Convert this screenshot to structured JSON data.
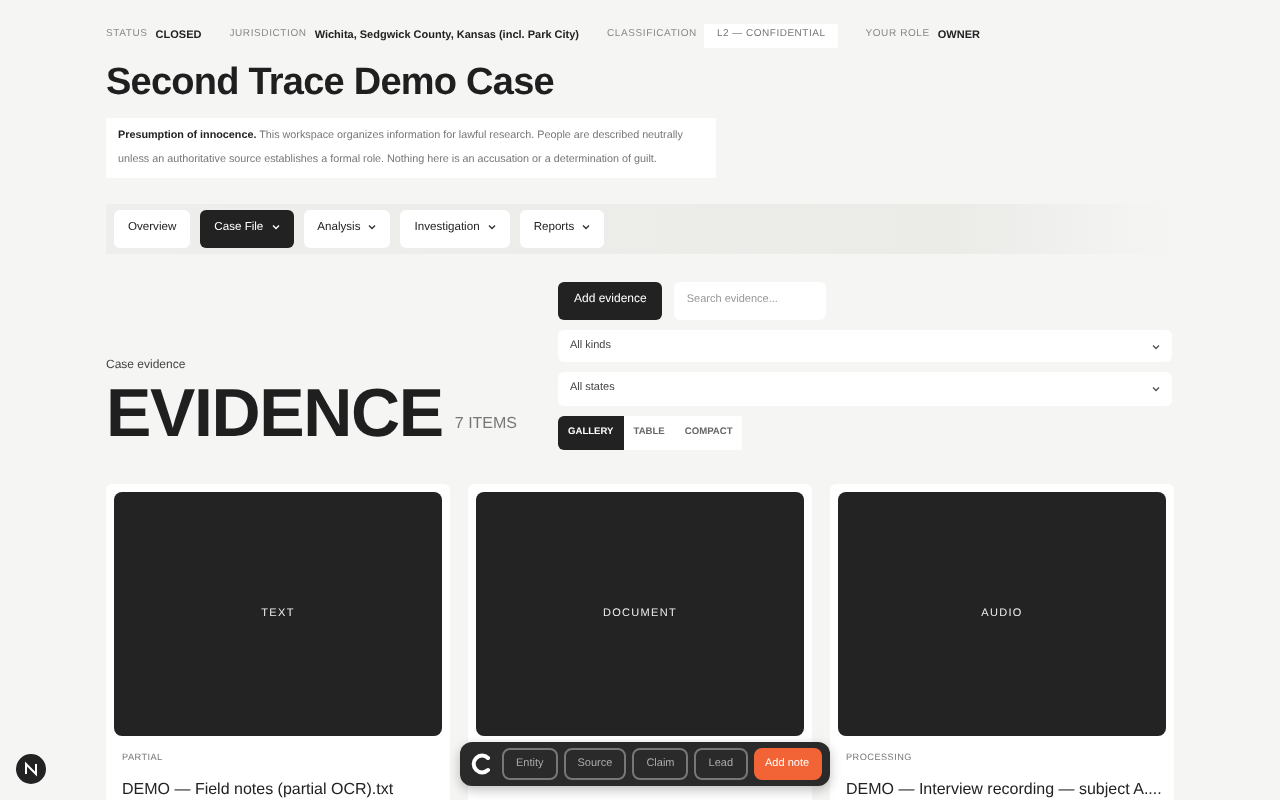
{
  "meta": [
    {
      "label": "STATUS",
      "value": "CLOSED",
      "kind": "plain"
    },
    {
      "label": "JURISDICTION",
      "value": "Wichita, Sedgwick County, Kansas (incl. Park City)",
      "kind": "plain"
    },
    {
      "label": "CLASSIFICATION",
      "value": "L2 — CONFIDENTIAL",
      "kind": "pill"
    },
    {
      "label": "YOUR ROLE",
      "value": "OWNER",
      "kind": "plain"
    }
  ],
  "title": "Second Trace Demo Case",
  "notice": "**Presumption of innocence.** This workspace organizes information for lawful research. People are described neutrally unless an authoritative source establishes a formal role. Nothing here is an accusation or a determination of guilt.",
  "tabs": [
    {
      "label": "Overview",
      "selected": false,
      "dropdown": false
    },
    {
      "label": "Case File",
      "selected": true,
      "dropdown": true
    },
    {
      "label": "Analysis",
      "selected": false,
      "dropdown": true
    },
    {
      "label": "Investigation",
      "selected": false,
      "dropdown": true
    },
    {
      "label": "Reports",
      "selected": false,
      "dropdown": true
    }
  ],
  "section": {
    "eyebrow": "Case evidence",
    "heading": "EVIDENCE",
    "count": "7 ITEMS"
  },
  "add_button": "Add evidence",
  "search": {
    "placeholder": "Search evidence..."
  },
  "filters": [
    {
      "value": "All kinds"
    },
    {
      "value": "All states"
    }
  ],
  "views": [
    {
      "label": "GALLERY",
      "selected": true
    },
    {
      "label": "TABLE",
      "selected": false
    },
    {
      "label": "COMPACT",
      "selected": false
    }
  ],
  "cards": [
    {
      "kind_label": "TEXT",
      "status": "PARTIAL",
      "title": "DEMO — Field notes (partial OCR).txt"
    },
    {
      "kind_label": "DOCUMENT"
    },
    {
      "kind_label": "AUDIO",
      "status": "PROCESSING",
      "title": "DEMO — Interview recording — subject A...."
    }
  ],
  "toolbar": {
    "buttons": [
      {
        "label": "Entity",
        "kind": "outline"
      },
      {
        "label": "Source",
        "kind": "outline"
      },
      {
        "label": "Claim",
        "kind": "outline"
      },
      {
        "label": "Lead",
        "kind": "outline"
      },
      {
        "label": "Add note",
        "kind": "accent"
      }
    ]
  }
}
